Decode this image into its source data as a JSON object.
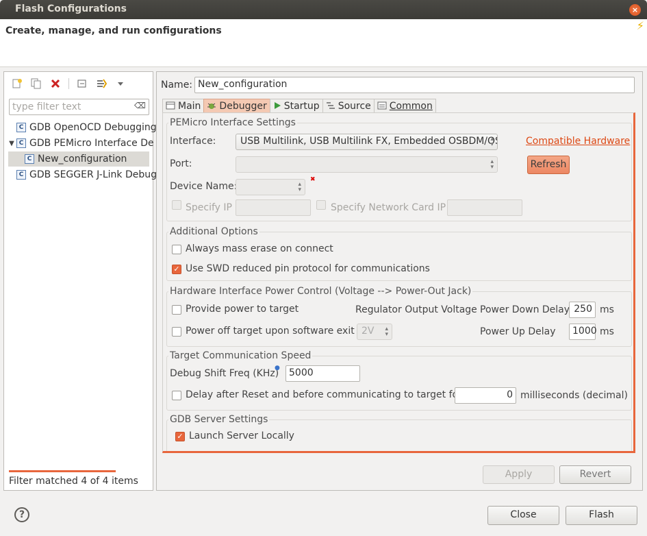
{
  "window": {
    "title": "Flash Configurations",
    "close_symbol": "×"
  },
  "header": {
    "subtitle": "Create, manage, and run configurations",
    "bolt_symbol": "⚡"
  },
  "left": {
    "toolbar_icons": [
      "new-config-icon",
      "duplicate-icon",
      "delete-icon",
      "collapse-all-icon",
      "filter-icon",
      "dropdown-icon"
    ],
    "filter_placeholder": "type filter text",
    "filter_clear_symbol": "⌫",
    "tree": [
      {
        "label": "GDB OpenOCD Debugging"
      },
      {
        "label": "GDB PEMicro Interface De"
      },
      {
        "label": "New_configuration"
      },
      {
        "label": "GDB SEGGER J-Link Debug"
      }
    ],
    "status": "Filter matched 4 of 4 items"
  },
  "right": {
    "name_label": "Name:",
    "name_value": "New_configuration",
    "tabs": [
      {
        "label": "Main"
      },
      {
        "label": "Debugger"
      },
      {
        "label": "Startup"
      },
      {
        "label": "Source"
      },
      {
        "label": "Common"
      }
    ],
    "pemicro": {
      "title": "PEMicro Interface Settings",
      "interface_label": "Interface:",
      "interface_value": "USB Multilink, USB Multilink FX, Embedded OSBDM/OSJTAG",
      "compatible_hardware": "Compatible Hardware",
      "port_label": "Port:",
      "refresh": "Refresh",
      "device_name_label": "Device Name:",
      "specify_ip": "Specify IP",
      "specify_network_card_ip": "Specify Network Card IP"
    },
    "additional": {
      "title": "Additional Options",
      "mass_erase": "Always mass erase on connect",
      "swd_reduced": "Use SWD reduced pin protocol for communications"
    },
    "power": {
      "title": "Hardware Interface Power Control (Voltage --> Power-Out Jack)",
      "provide_power": "Provide power to target",
      "regulator_voltage": "Regulator Output Voltage",
      "power_down_delay_label": "Power Down Delay",
      "power_down_delay_value": "250",
      "ms1": "ms",
      "power_off_exit": "Power off target upon software exit",
      "voltage_value": "2V",
      "power_up_delay_label": "Power Up Delay",
      "power_up_delay_value": "1000",
      "ms2": "ms"
    },
    "speed": {
      "title": "Target Communication Speed",
      "shift_freq_label": "Debug Shift Freq (KHz)",
      "shift_freq_value": "5000",
      "delay_label": "Delay after Reset and before communicating to target for",
      "delay_value": "0",
      "delay_units": "milliseconds (decimal)"
    },
    "gdb": {
      "title": "GDB Server Settings",
      "launch_locally": "Launch Server Locally"
    },
    "apply": "Apply",
    "revert": "Revert"
  },
  "footer": {
    "help_symbol": "?",
    "close": "Close",
    "flash": "Flash"
  },
  "colors": {
    "accent": "#e8663c",
    "link": "#dd4814"
  }
}
